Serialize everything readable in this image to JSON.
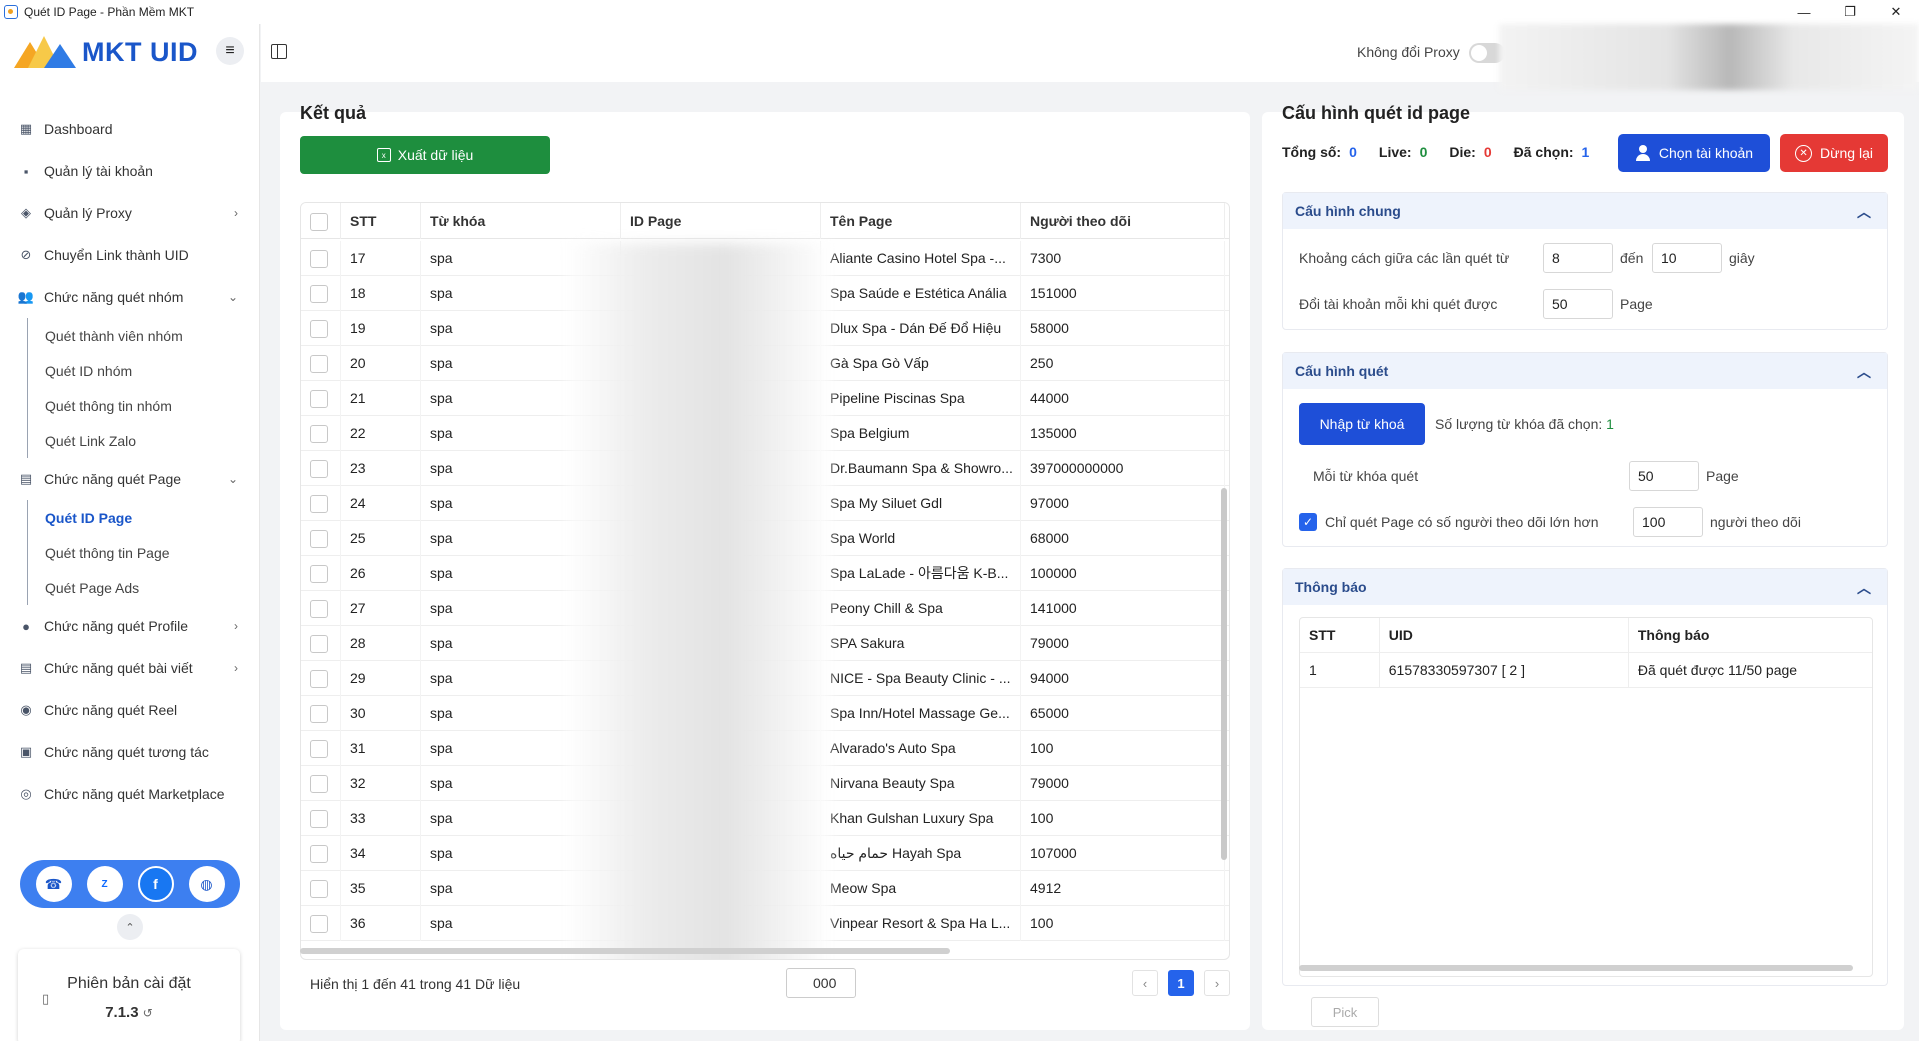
{
  "window": {
    "title": "Quét ID Page - Phần Mềm MKT"
  },
  "brand": {
    "logo_text": "MKT UID"
  },
  "sidebar": {
    "items": [
      {
        "label": "Dashboard",
        "icon": "dashboard-icon"
      },
      {
        "label": "Quản lý tài khoản",
        "icon": "grid-icon"
      },
      {
        "label": "Quản lý Proxy",
        "icon": "layers-icon"
      },
      {
        "label": "Chuyển Link thành UID",
        "icon": "link-icon"
      },
      {
        "label": "Chức năng quét nhóm",
        "icon": "group-icon"
      },
      {
        "label": "Chức năng quét Page",
        "icon": "page-icon"
      },
      {
        "label": "Chức năng quét Profile",
        "icon": "user-icon"
      },
      {
        "label": "Chức năng quét bài viết",
        "icon": "post-icon"
      },
      {
        "label": "Chức năng quét Reel",
        "icon": "reel-icon"
      },
      {
        "label": "Chức năng quét tương tác",
        "icon": "interaction-icon"
      },
      {
        "label": "Chức năng quét Marketplace",
        "icon": "marketplace-icon"
      }
    ],
    "group_sub": [
      "Quét thành viên nhóm",
      "Quét ID nhóm",
      "Quét thông tin nhóm",
      "Quét Link Zalo"
    ],
    "page_sub": [
      "Quét ID Page",
      "Quét thông tin Page",
      "Quét Page Ads"
    ],
    "version_label": "Phiên bản cài đặt",
    "version": "7.1.3"
  },
  "topbar": {
    "proxy_label": "Không đổi Proxy"
  },
  "results": {
    "title": "Kết quả",
    "export_label": "Xuất dữ liệu",
    "columns": [
      "STT",
      "Từ khóa",
      "ID Page",
      "Tên Page",
      "Người theo dõi"
    ],
    "rows": [
      {
        "stt": "17",
        "kw": "spa",
        "name": "Aliante Casino Hotel Spa -...",
        "followers": "7300"
      },
      {
        "stt": "18",
        "kw": "spa",
        "name": "Spa Saúde e Estética Anália",
        "followers": "151000"
      },
      {
        "stt": "19",
        "kw": "spa",
        "name": "Dlux Spa - Dán Đế Đổ Hiệu",
        "followers": "58000"
      },
      {
        "stt": "20",
        "kw": "spa",
        "name": "Gà Spa Gò Vấp",
        "followers": "250"
      },
      {
        "stt": "21",
        "kw": "spa",
        "name": "Pipeline Piscinas Spa",
        "followers": "44000"
      },
      {
        "stt": "22",
        "kw": "spa",
        "name": "Spa Belgium",
        "followers": "135000"
      },
      {
        "stt": "23",
        "kw": "spa",
        "name": "Dr.Baumann Spa & Showro...",
        "followers": "397000000000"
      },
      {
        "stt": "24",
        "kw": "spa",
        "name": "Spa My Siluet Gdl",
        "followers": "97000"
      },
      {
        "stt": "25",
        "kw": "spa",
        "name": "Spa World",
        "followers": "68000"
      },
      {
        "stt": "26",
        "kw": "spa",
        "name": "Spa LaLade - 아름다움 K-B...",
        "followers": "100000"
      },
      {
        "stt": "27",
        "kw": "spa",
        "name": "Peony Chill & Spa",
        "followers": "141000"
      },
      {
        "stt": "28",
        "kw": "spa",
        "name": "SPA Sakura",
        "followers": "79000"
      },
      {
        "stt": "29",
        "kw": "spa",
        "name": "NICE - Spa Beauty Clinic - ...",
        "followers": "94000"
      },
      {
        "stt": "30",
        "kw": "spa",
        "name": "Spa Inn/Hotel Massage Ge...",
        "followers": "65000"
      },
      {
        "stt": "31",
        "kw": "spa",
        "name": "Alvarado's Auto Spa",
        "followers": "100"
      },
      {
        "stt": "32",
        "kw": "spa",
        "name": "Nirvana Beauty Spa",
        "followers": "79000"
      },
      {
        "stt": "33",
        "kw": "spa",
        "name": "Khan Gulshan Luxury Spa",
        "followers": "100"
      },
      {
        "stt": "34",
        "kw": "spa",
        "name": "حمام حياه Hayah Spa",
        "followers": "107000"
      },
      {
        "stt": "35",
        "kw": "spa",
        "name": "Meow Spa",
        "followers": "4912"
      },
      {
        "stt": "36",
        "kw": "spa",
        "name": "Vinpear Resort & Spa Ha L...",
        "followers": "100"
      }
    ],
    "footer": "Hiển thị 1 đến 41 trong 41 Dữ liệu",
    "page_size": "000",
    "current_page": "1"
  },
  "config": {
    "title": "Cấu hình quét id page",
    "stats": {
      "total_label": "Tổng số:",
      "total": "0",
      "live_label": "Live:",
      "live": "0",
      "die_label": "Die:",
      "die": "0",
      "selected_label": "Đã chọn:",
      "selected": "1"
    },
    "pick_account_label": "Chọn tài khoản",
    "stop_label": "Dừng lại",
    "general": {
      "title": "Cấu hình chung",
      "interval_label": "Khoảng cách giữa các lần quét từ",
      "interval_from": "8",
      "to_label": "đến",
      "interval_to": "10",
      "unit_seconds": "giây",
      "switch_label": "Đổi tài khoản mỗi khi quét được",
      "switch_value": "50",
      "switch_unit": "Page"
    },
    "scan": {
      "title": "Cấu hình quét",
      "import_label": "Nhập từ khoá",
      "count_label": "Số lượng từ khóa đã chọn:",
      "count": "1",
      "per_kw_label": "Mỗi từ khóa quét",
      "per_kw_value": "50",
      "per_kw_unit": "Page",
      "filter_label": "Chỉ quét Page có số người theo dõi lớn hơn",
      "filter_value": "100",
      "filter_unit": "người theo dõi"
    },
    "notify": {
      "title": "Thông báo",
      "columns": [
        "STT",
        "UID",
        "Thông báo"
      ],
      "rows": [
        {
          "stt": "1",
          "uid": "61578330597307 [ 2 ]",
          "msg": "Đã quét được 11/50 page"
        }
      ],
      "pick_label": "Pick"
    }
  },
  "colors": {
    "primary": "#1e4fd8",
    "success": "#1e8e3e",
    "danger": "#e53935",
    "live": "#1e8e3e",
    "die": "#e53935",
    "selected": "#2563eb"
  }
}
